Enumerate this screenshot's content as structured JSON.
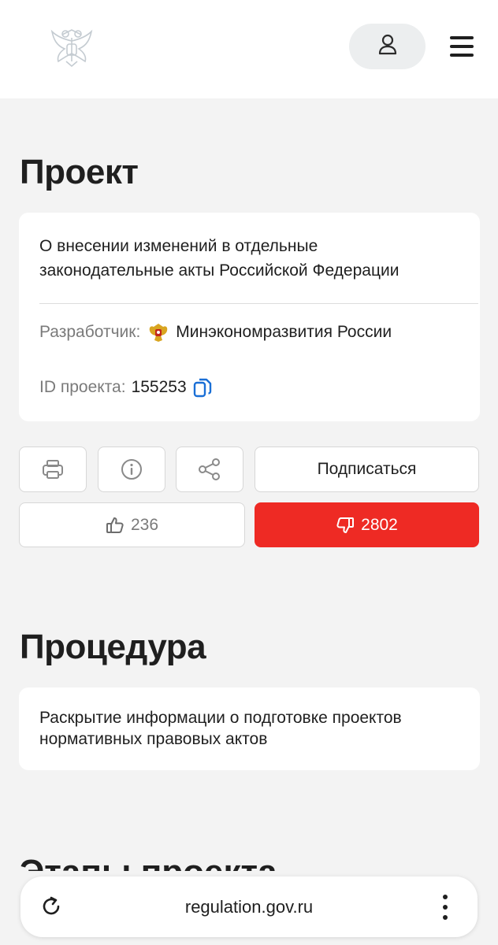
{
  "header": {
    "emblem_icon": "coat-of-arms-icon",
    "user_icon": "user-icon",
    "menu_icon": "hamburger-menu-icon"
  },
  "project": {
    "title": "Проект",
    "name_line1": "О внесении изменений в отдельные",
    "name_line2": "законодательные акты Российской Федерации",
    "developer_label": "Разработчик:",
    "developer_value": "Минэкономразвития России",
    "id_label": "ID проекта:",
    "id_value": "155253",
    "copy_icon": "copy-icon"
  },
  "actions": {
    "print_icon": "printer-icon",
    "info_icon": "info-icon",
    "share_icon": "share-icon",
    "subscribe_label": "Подписаться",
    "likes": "236",
    "dislikes": "2802",
    "like_icon": "thumbs-up-icon",
    "dislike_icon": "thumbs-down-icon",
    "dislike_color": "#ee2a24"
  },
  "procedure": {
    "title": "Процедура",
    "text_line1": "Раскрытие информации о подготовке проектов",
    "text_line2": "нормативных правовых актов"
  },
  "next_section": {
    "title": "Этапы проекта"
  },
  "browser": {
    "url": "regulation.gov.ru",
    "reload_icon": "reload-icon",
    "more_icon": "more-vertical-icon"
  }
}
